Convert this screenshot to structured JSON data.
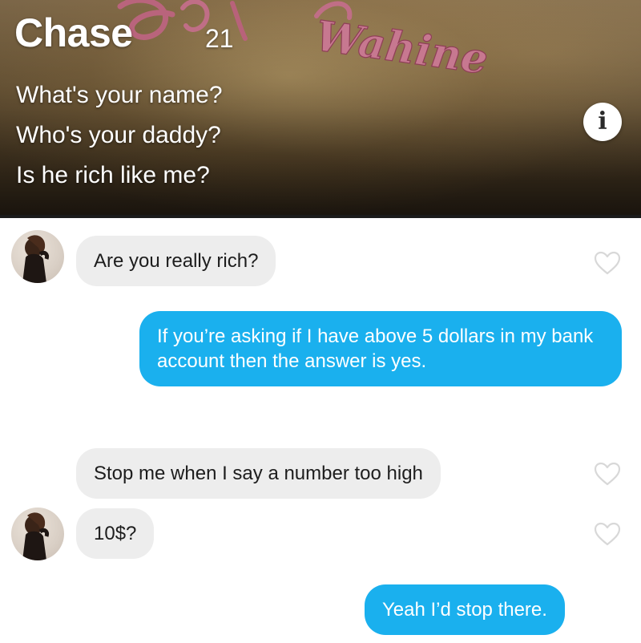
{
  "profile": {
    "name": "Chase",
    "age": "21",
    "bio_lines": [
      "What's your name?",
      "Who's your daddy?",
      "Is he rich like me?"
    ],
    "tattoo_text": "Wahine",
    "info_button_glyph": "i"
  },
  "messages": [
    {
      "direction": "incoming",
      "text": "Are you really rich?",
      "has_avatar": true,
      "liked": false
    },
    {
      "direction": "outgoing",
      "text": "If you’re asking if I have above 5 dollars in my bank account then the answer is yes."
    },
    {
      "direction": "incoming",
      "text": "Stop me when I say a number too high",
      "has_avatar": false,
      "liked": false
    },
    {
      "direction": "incoming",
      "text": "10$?",
      "has_avatar": true,
      "liked": false
    },
    {
      "direction": "outgoing",
      "text": "Yeah I’d stop there."
    }
  ],
  "colors": {
    "outgoing_bubble": "#1ab0ee",
    "incoming_bubble": "#ededed",
    "heart_outline": "#d8d8d8"
  },
  "icons": {
    "info": "info-icon",
    "like": "heart-outline-icon",
    "avatar": "user-photo"
  }
}
